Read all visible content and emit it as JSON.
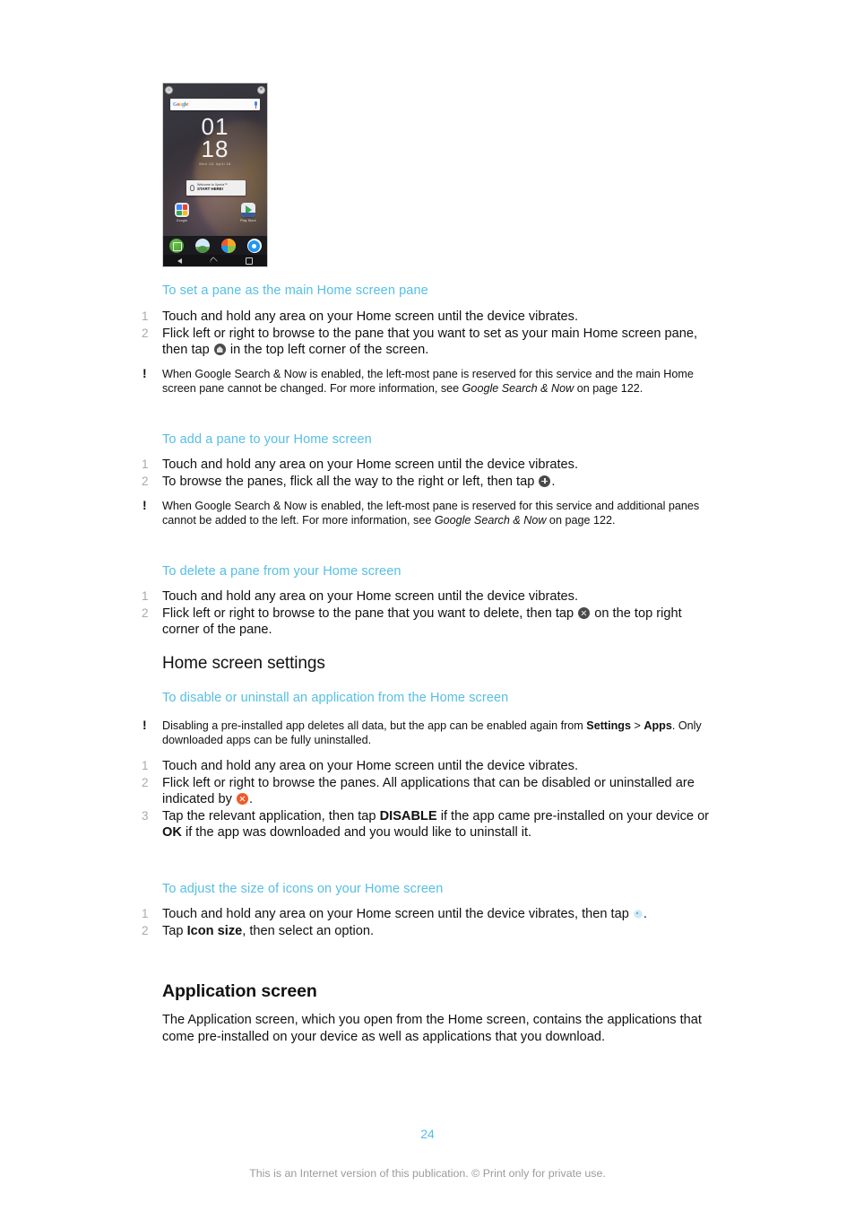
{
  "document": {
    "page_number": "24",
    "footer": "This is an Internet version of this publication. © Print only for private use."
  },
  "figure": {
    "name": "home-screen-phone-screenshot",
    "search_widget": {
      "logo_letters": [
        "G",
        "o",
        "o",
        "g",
        "l",
        "e"
      ],
      "mic_icon": "microphone-icon"
    },
    "clock": {
      "hours": "01",
      "minutes": "18",
      "date": "Mon 18, April 18"
    },
    "welcome_card": {
      "line1": "Welcome to Xperia™",
      "line2": "START HERE!"
    },
    "home_apps": [
      {
        "label": "Google",
        "icon": "google-folder-icon"
      },
      {
        "label": "Play Store",
        "icon": "play-store-icon"
      }
    ],
    "dock": [
      {
        "label": "Widgets",
        "icon": "widgets-icon"
      },
      {
        "label": "Wallpapers",
        "icon": "wallpapers-icon"
      },
      {
        "label": "Themes",
        "icon": "themes-icon"
      },
      {
        "label": "Settings",
        "icon": "settings-icon"
      }
    ],
    "navbar": [
      "back-icon",
      "home-icon",
      "recents-icon"
    ],
    "corner_badges": [
      "set-main-pane-icon",
      "delete-pane-icon"
    ]
  },
  "sections": [
    {
      "id": "set-main-pane",
      "heading": "To set a pane as the main Home screen pane",
      "steps": [
        {
          "num": "1",
          "text": "Touch and hold any area on your Home screen until the device vibrates."
        },
        {
          "num": "2",
          "text_before": "Flick left or right to browse to the pane that you want to set as your main Home screen pane, then tap ",
          "icon": "home-pane-icon",
          "text_after": " in the top left corner of the screen."
        }
      ],
      "note": {
        "marker": "!",
        "before_italic": "When Google Search & Now is enabled, the left-most pane is reserved for this service and the main Home screen pane cannot be changed. For more information, see ",
        "italic": "Google Search & Now",
        "after_italic": " on page 122."
      }
    },
    {
      "id": "add-pane",
      "heading": "To add a pane to your Home screen",
      "steps": [
        {
          "num": "1",
          "text": "Touch and hold any area on your Home screen until the device vibrates."
        },
        {
          "num": "2",
          "text_before": "To browse the panes, flick all the way to the right or left, then tap ",
          "icon": "add-pane-icon",
          "text_after": "."
        }
      ],
      "note": {
        "marker": "!",
        "before_italic": "When Google Search & Now is enabled, the left-most pane is reserved for this service and additional panes cannot be added to the left. For more information, see ",
        "italic": "Google Search & Now",
        "after_italic": " on page 122."
      }
    },
    {
      "id": "delete-pane",
      "heading": "To delete a pane from your Home screen",
      "steps": [
        {
          "num": "1",
          "text": "Touch and hold any area on your Home screen until the device vibrates."
        },
        {
          "num": "2",
          "text_before": "Flick left or right to browse to the pane that you want to delete, then tap ",
          "icon": "delete-pane-icon",
          "text_after": " on the top right corner of the pane."
        }
      ]
    }
  ],
  "home_screen_settings": {
    "heading": "Home screen settings",
    "subsections": [
      {
        "id": "disable-uninstall-app",
        "heading": "To disable or uninstall an application from the Home screen",
        "note": {
          "marker": "!",
          "part1": "Disabling a pre-installed app deletes all data, but the app can be enabled again from ",
          "bold1": "Settings",
          "part2": " > ",
          "bold2": "Apps",
          "part3": ". Only downloaded apps can be fully uninstalled."
        },
        "steps": [
          {
            "num": "1",
            "text": "Touch and hold any area on your Home screen until the device vibrates."
          },
          {
            "num": "2",
            "text_before": "Flick left or right to browse the panes. All applications that can be disabled or uninstalled are indicated by ",
            "icon": "uninstall-indicator-icon",
            "text_after": "."
          },
          {
            "num": "3",
            "part1": "Tap the relevant application, then tap ",
            "bold1": "DISABLE",
            "part2": " if the app came pre-installed on your device or ",
            "bold2": "OK",
            "part3": " if the app was downloaded and you would like to uninstall it."
          }
        ]
      },
      {
        "id": "adjust-icon-size",
        "heading": "To adjust the size of icons on your Home screen",
        "steps": [
          {
            "num": "1",
            "text_before": "Touch and hold any area on your Home screen until the device vibrates, then tap ",
            "icon": "icon-size-settings-icon",
            "text_after": "."
          },
          {
            "num": "2",
            "part1": "Tap ",
            "bold1": "Icon size",
            "part2": ", then select an option."
          }
        ]
      }
    ]
  },
  "application_screen": {
    "heading": "Application screen",
    "paragraph": "The Application screen, which you open from the Home screen, contains the applications that come pre-installed on your device as well as applications that you download."
  },
  "colors": {
    "heading_blue": "#55bfe4",
    "page_number_blue": "#55bfe4",
    "footer_gray": "#9b9b9b",
    "step_number_gray": "#a9a9a9",
    "uninstall_orange": "#ef5a28"
  }
}
